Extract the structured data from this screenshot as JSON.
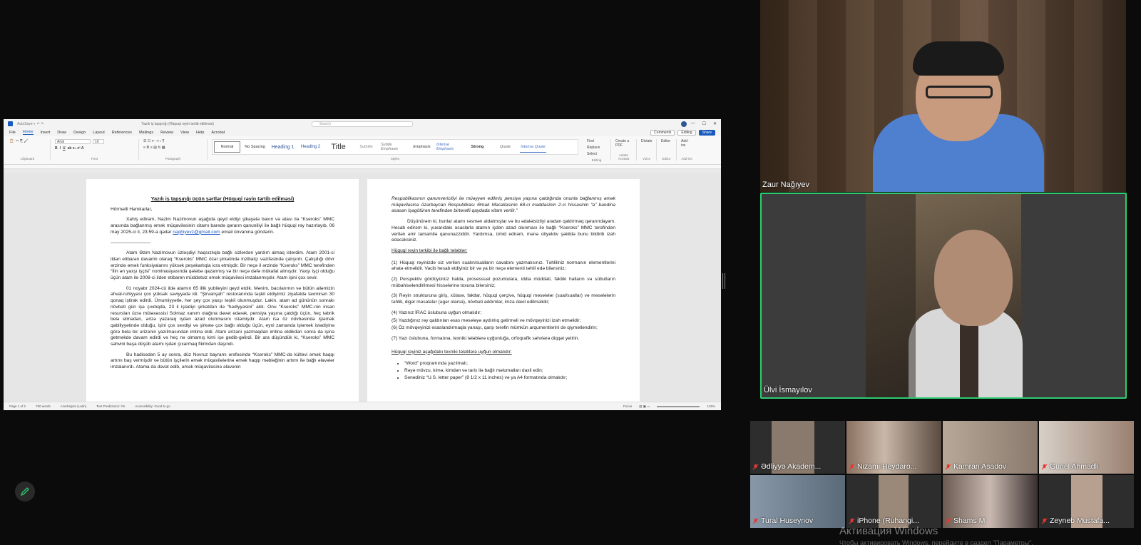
{
  "word": {
    "title": "Yazılı iş tapşırığı (Hüquqi rəyin tərtib edilməsi)",
    "search_placeholder": "Search",
    "menu": [
      "File",
      "Home",
      "Insert",
      "Draw",
      "Design",
      "Layout",
      "References",
      "Mailings",
      "Review",
      "View",
      "Help",
      "Acrobat"
    ],
    "active_menu": "Home",
    "comments_label": "Comments",
    "editing_label": "Editing",
    "share_label": "Share",
    "font_name": "Arial",
    "font_size": "10",
    "styles": [
      "Normal",
      "No Spacing",
      "Heading 1",
      "Heading 2",
      "Title",
      "Subtitle",
      "Subtle Emphasis",
      "Emphasis",
      "Intense Emphasis",
      "Strong",
      "Quote",
      "Intense Quote"
    ],
    "groups": {
      "clipboard": "Clipboard",
      "font": "Font",
      "paragraph": "Paragraph",
      "styles": "Styles",
      "editing": "Editing",
      "adobe": "Adobe Acrobat",
      "voice": "Voice",
      "editor": "Editor",
      "addins": "Add-ins"
    },
    "ribbon_right": {
      "find": "Find",
      "replace": "Replace",
      "select": "Select",
      "create_pdf": "Create a PDF",
      "dictate": "Dictate",
      "editor": "Editor",
      "addins": "Add-ins"
    },
    "status": {
      "page": "Page 1 of 2",
      "words": "750 words",
      "language": "Azerbaijani (Latin)",
      "predictions": "Text Predictions: On",
      "accessibility": "Accessibility: Good to go",
      "focus": "Focus",
      "zoom": "126%"
    }
  },
  "doc": {
    "left_page": {
      "title": "Yazılı iş tapşırığı üçün şərtlər (Hüquqi rəyin tərtib edilməsi)",
      "salutation": "Hörmətli Həmkarlar,",
      "p1_a": "Xahiş edirəm, Nazim Nazimovun aşağıda qeyd etdiyi şikayətə baxın və atası ilə “Kseroks” MMC arasında bağlanmış əmək müqaviləsinin xitamı barədə qərarın qanuniliyi ilə bağlı hüquqi rəy hazırlayıb, 06 may 2025-ci il, 23:59-a qədər",
      "email": "naghiyevz@gmail.com",
      "p1_b": "email ünvanına göndərin.",
      "separator": "------------------------------------------------",
      "p2": "Atam Əzim Nazimovun üzləşdiyi haqsızlıqla bağlı sizlərdən yardım almaq istərdim. Atam 2001-ci ildən etibarən davamlı olaraq “Kseroks” MMC özəl şirkətində inzibatçı vəzifəsində çalışırdı. Çalışdığı dövr ərzində əmək funksiyalarını yüksək peşəkarlıqla icra etmişdir. Bir neçə il ərzində “Kseroks” MMC tərəfindən “İlin ən yaxşı işçisi” nominasiyasında qələbə qazanmış və bir neçə dəfə mükafat almışdır. Yaxşı işçi olduğu üçün atam ilə 2008-ci ildən etibarən müddətsiz əmək müqaviləsi imzalanmışdır. Atam işini çox sevir.",
      "p3": "01 noyabr 2024-cü ildə atamın 65 illik yubileyini qeyd etdik. Mənim, bacılarımın və bütün ailəmizin əhval-ruhiyyəsi çox yüksək səviyyədə idi. “Şirvanşah” restoranında təşkil etdiyimiz ziyafətdə təxminən 30 qonaq iştirak edirdi. Ümumiyyətlə, hər şey çox yaxşı təşkil olunmuşdur. Lakin, atam ad gününün sonrakı növbəti gün işə çıxdıqda, 23 il işlədiyi şirkətdən də “hədiyyəsini” aldı. Onu “Kseroks” MMC-nin insan resursları üzrə mütəxəssisi Solmaz xanım otağına dəvət edərək, pensiya yaşına çatdığı üçün, heç təbrik belə etmədən, ərizə yazaraq işdən azad olunmasını istəmişdir. Atam isə öz növbəsində işləmək qabiliyyətində olduğu, işini çox sevdiyi və şirkətə çox bağlı olduğu üçün, eyni zamanda işləmək istədiyinə görə belə bir ərizənin yazılmasından imtina etdi. Atam ərizəni yazmaqdan imtina etdikdən sonra da işinə getməkdə davam edirdi və heç nə olmamış kimi işə gedib-gəlirdi. Bir ara düşündük ki, “Kseroks” MMC səhvini başa düşüb atamı işdən çıxarmaq fikrindən daşındı.",
      "p4": "Bu hadisədən 5 ay sonra, düz Novruz bayramı ərəfəsində “Kseroks” MMC-də kütləvi əmək haqqı artımı baş vermişdir və bütün işçilərin əmək müqavilələrinə əmək haqqı məbləğinin artımı ilə bağlı əlavələr imzalanırdı. Atama da dəvət edib, əmək müqaviləsinə əlavənin"
    },
    "right_page": {
      "p1": "Respublikasının qanunvericiliyi ilə müəyyən edilmiş pensiya yaşına çatdığında onunla bağlanmış əmək müqaviləsinə Azərbaycan Respublikası Əmək Məcəlləsinin 68-ci maddəsinin 2-ci hissəsinin “ə” bəndinə əsasən İşəgötürən tərəfindən birtərəfli qaydada xitam verilir.”",
      "p2": "Düşünürəm ki, bunlar atamı rəsmən aldatmışlar və bu ədalətsizliyi aradan qaldırmaq qərarındayam. Hesab edirəm ki, yuxarıdakı əsaslarla atamın işdən azad olunması ilə bağlı “Kseroks” MMC tərəfindən verilən əmr tamamilə qanunazziddir. Yardımsa, ümid edirəm, mənə obyektiv şəkildə bunu bildirib izah edəcəksiniz.",
      "h1": "Hüquqi rəyin tərkibi ilə bağlı tələblər:",
      "items": [
        "(1) Hüquqi rəyinizdə siz verilən sualın/sualların cavabını yazmalısınız. Təhliliniz normanın elementlərini əhatə etməlidir. Vacib hesab etdiyiniz bir və ya bir neçə elementi təhlil edə bilərsiniz;",
        "(2) Perspektiv gördüyünüz halda, prosessual pozuntulara, iddia müddəti, faktiki halların və sübutların mübahisələndirilməsi hissələrinə toxuna bilərsiniz;",
        "(3) Rəyin strukturuna giriş, xülasə, faktlar, hüquqi çərçivə, hüquqi məsələlər (sual/suallar) və məsələlərin təhlili, digər məsələlər (əgər olarsa), növbəti addımlar, imza daxil edilməlidir;",
        "(4) Yazınız İRAC üslubuna uyğun olmalıdır;",
        "(5) Yazdığınız rəy qaldırılan əsas məsələyə aydınlıq gətirməli və mövqeyinizi izah etməlidir;",
        "(6) Öz mövqeyinizi əsaslandırmaqla yanaşı, qarşı tərəfin mümkün arqumentlərini də qiymətləndirin;",
        "(7) Yazı üslubuna, formatına, texniki tələblərə uyğunluğa, orfoqrafik səhvlərə diqqət yetirin."
      ],
      "h2": "Hüquqi rəyiniz aşağıdakı texniki tələblərə uyğun olmalıdır:",
      "bullets": [
        "“Word” proqramında yazılmalı;",
        "Rəyə mövzu, kimə, kimdən və tarix ilə bağlı məlumatları daxil edin;",
        "Sənədiniz “U.S. letter paper” (8 1/2 x 11 inches) və ya A4 formatında olmalıdır;"
      ]
    }
  },
  "participants": {
    "main1": "Zaur Nağıyev",
    "main2": "Ülvi İsmayılov",
    "grid": [
      "Ədliyyə Akadem...",
      "Nizami Heydaro...",
      "Kamran Asadov",
      "Gunel Ahmadli",
      "Tural Huseynov",
      "iPhone (Ruhangi...",
      "Shams M",
      "Zeyneb Mustafa..."
    ]
  },
  "watermark": {
    "title": "Активация Windows",
    "subtitle": "Чтобы активировать Windows, перейдите в раздел \"Параметры\"."
  },
  "colors": {
    "active_speaker_border": "#2ecc71",
    "muted_icon": "#e53935",
    "word_blue": "#185abd"
  }
}
